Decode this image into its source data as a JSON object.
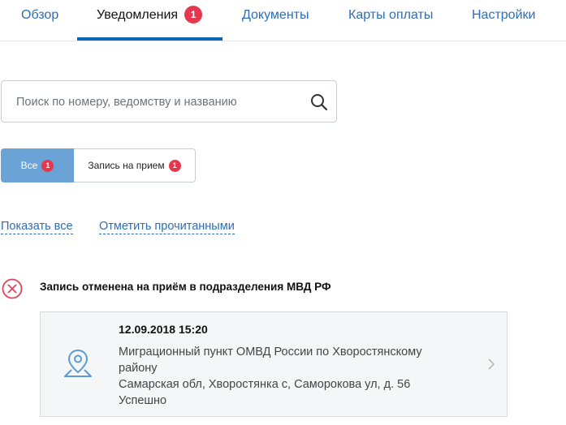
{
  "tabs": [
    {
      "label": "Обзор"
    },
    {
      "label": "Уведомления",
      "badge": "1",
      "active": true
    },
    {
      "label": "Документы"
    },
    {
      "label": "Карты оплаты"
    },
    {
      "label": "Настройки"
    }
  ],
  "search": {
    "placeholder": "Поиск по номеру, ведомству и названию",
    "icon": "search-icon"
  },
  "filters": {
    "all": {
      "label": "Все",
      "badge": "1"
    },
    "appointment": {
      "label": "Запись на прием",
      "badge": "1"
    }
  },
  "links": {
    "show_all": "Показать все",
    "mark_read": "Отметить прочитанными"
  },
  "notification": {
    "title": "Запись отменена на приём в подразделения МВД РФ",
    "status_icon": "cancel-circle-icon",
    "date": "12.09.2018 15:20",
    "place_line1": "Миграционный пункт ОМВД России по Хворостянскому",
    "place_line2": "району",
    "address": "Самарская обл, Хворостянка с, Саморокова ул, д. 56",
    "result": "Успешно"
  },
  "colors": {
    "accent": "#0d66b8",
    "link": "#2f6db4",
    "badge": "#e5384e",
    "active_filter": "#6ba3d6"
  }
}
